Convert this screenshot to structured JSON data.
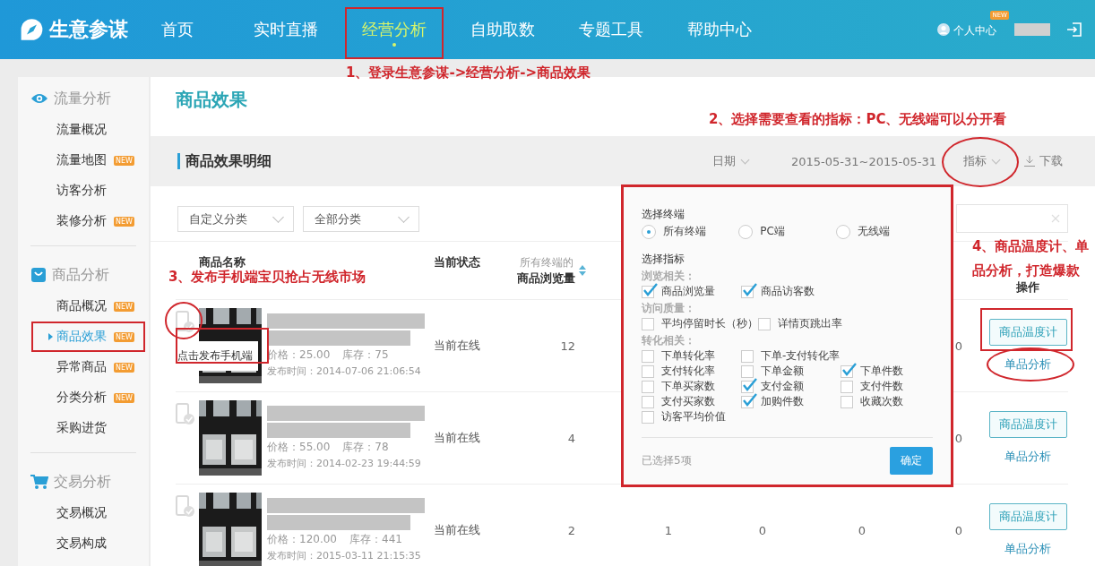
{
  "header": {
    "logo": "生意参谋",
    "nav": [
      {
        "label": "首页",
        "selected": false,
        "highlighted": false
      },
      {
        "label": "实时直播",
        "selected": false,
        "highlighted": false
      },
      {
        "label": "经营分析",
        "selected": true,
        "highlighted": true
      },
      {
        "label": "自助取数",
        "selected": false,
        "highlighted": false
      },
      {
        "label": "专题工具",
        "selected": false,
        "highlighted": false
      },
      {
        "label": "帮助中心",
        "selected": false,
        "highlighted": false
      }
    ],
    "user": {
      "label": "个人中心",
      "badge": "NEW"
    }
  },
  "sidebar": [
    {
      "title": "流量分析",
      "kind": "eye",
      "items": [
        {
          "label": "流量概况",
          "selected": false,
          "highlighted": false
        },
        {
          "label": "流量地图",
          "badge": "NEW",
          "selected": false,
          "highlighted": false
        },
        {
          "label": "访客分析",
          "selected": false,
          "highlighted": false
        },
        {
          "label": "装修分析",
          "badge": "NEW",
          "selected": false,
          "highlighted": false
        }
      ]
    },
    {
      "title": "商品分析",
      "kind": "bag",
      "items": [
        {
          "label": "商品概况",
          "badge": "NEW",
          "selected": false,
          "highlighted": false
        },
        {
          "label": "商品效果",
          "badge": "NEW",
          "selected": true,
          "highlighted": true
        },
        {
          "label": "异常商品",
          "badge": "NEW",
          "selected": false,
          "highlighted": false
        },
        {
          "label": "分类分析",
          "badge": "NEW",
          "selected": false,
          "highlighted": false
        },
        {
          "label": "采购进货",
          "selected": false,
          "highlighted": false
        }
      ]
    },
    {
      "title": "交易分析",
      "kind": "cart",
      "items": [
        {
          "label": "交易概况",
          "selected": false,
          "highlighted": false
        },
        {
          "label": "交易构成",
          "selected": false,
          "highlighted": false
        }
      ]
    }
  ],
  "page_title": "商品效果",
  "section": {
    "title": "商品效果明细",
    "date_label": "日期",
    "date_range": "2015-05-31~2015-05-31",
    "metrics_label": "指标",
    "metrics_highlighted": true,
    "download": "下载"
  },
  "filters": [
    "自定义分类",
    "全部分类"
  ],
  "table": {
    "columns": {
      "name": "商品名称",
      "status": "当前状态",
      "views_top": "所有终端的",
      "views": "商品浏览量",
      "ops": "操作"
    },
    "rows": [
      {
        "price": "价格：25.00",
        "stock": "库存：75",
        "published": "发布时间：2014-07-06 21:06:54",
        "status": "当前在线",
        "values": {
          "views": "12",
          "column_7": "0"
        },
        "tooltip": "点击发布手机端",
        "highlighted": true,
        "button": "商品温度计",
        "link": "单品分析"
      },
      {
        "price": "价格：55.00",
        "stock": "库存：78",
        "published": "发布时间：2014-02-23 19:44:59",
        "status": "当前在线",
        "values": {
          "views": "4",
          "column_7": "0"
        },
        "highlighted": false,
        "button": "商品温度计",
        "link": "单品分析"
      },
      {
        "price": "价格：120.00",
        "stock": "库存：441",
        "published": "发布时间：2015-03-11 21:15:35",
        "status": "当前在线",
        "values": {
          "views": "2",
          "column_4": "1",
          "column_5": "0",
          "column_6": "0",
          "column_7": "0"
        },
        "highlighted": false,
        "button": "商品温度计",
        "link": "单品分析"
      }
    ]
  },
  "metric_popup": {
    "highlighted": true,
    "terminal_label": "选择终端",
    "terminals": [
      {
        "label": "所有终端",
        "selected": true
      },
      {
        "label": "PC端",
        "selected": false
      },
      {
        "label": "无线端",
        "selected": false
      }
    ],
    "metric_label": "选择指标",
    "groups": [
      {
        "title": "浏览相关：",
        "rows": [
          [
            {
              "label": "商品浏览量",
              "checked": true
            },
            {
              "label": "商品访客数",
              "checked": true
            }
          ]
        ]
      },
      {
        "title": "访问质量：",
        "rows": [
          [
            {
              "label": "平均停留时长（秒）",
              "checked": false
            },
            {
              "label": "详情页跳出率",
              "checked": false
            }
          ]
        ]
      },
      {
        "title": "转化相关：",
        "rows": [
          [
            {
              "label": "下单转化率",
              "checked": false
            },
            {
              "label": "下单-支付转化率",
              "checked": false
            }
          ],
          [
            {
              "label": "支付转化率",
              "checked": false
            },
            {
              "label": "下单金额",
              "checked": false
            },
            {
              "label": "下单件数",
              "checked": true
            }
          ],
          [
            {
              "label": "下单买家数",
              "checked": false
            },
            {
              "label": "支付金额",
              "checked": true
            },
            {
              "label": "支付件数",
              "checked": false
            }
          ],
          [
            {
              "label": "支付买家数",
              "checked": false
            },
            {
              "label": "加购件数",
              "checked": true
            },
            {
              "label": "收藏次数",
              "checked": false
            }
          ],
          [
            {
              "label": "访客平均价值",
              "checked": false
            }
          ]
        ]
      }
    ],
    "selected_count": "已选择5项",
    "confirm": "确定"
  },
  "annotations": [
    "1、登录生意参谋->经营分析->商品效果",
    "2、选择需要查看的指标：PC、无线端可以分开看",
    "3、发布手机端宝贝抢占无线市场",
    "4、商品温度计、单品分析，打造爆款"
  ]
}
